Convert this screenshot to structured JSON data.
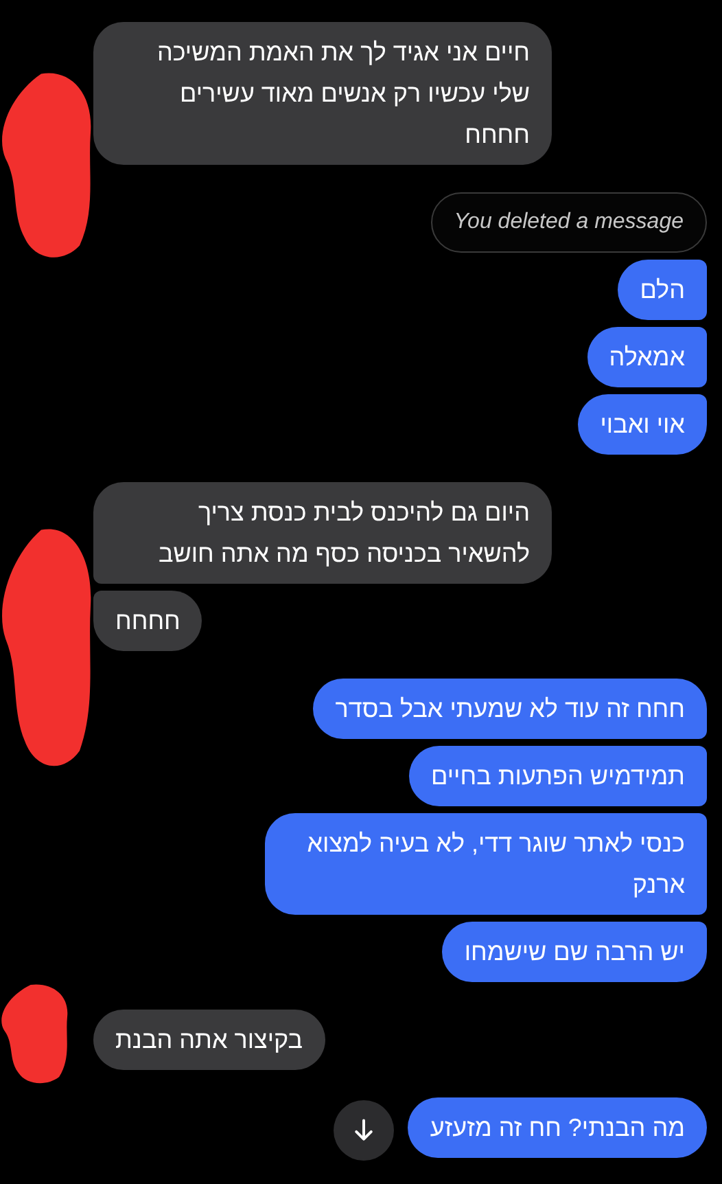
{
  "groups": [
    {
      "outgoing": false,
      "messages": [
        {
          "kind": "text",
          "text": "חיים אני אגיד לך את האמת המשיכה שלי עכשיו רק אנשים מאוד עשירים חחחח"
        }
      ]
    },
    {
      "outgoing": true,
      "messages": [
        {
          "kind": "deleted",
          "text": "You deleted a message"
        },
        {
          "kind": "text",
          "text": "הלם"
        },
        {
          "kind": "text",
          "text": "אמאלה"
        },
        {
          "kind": "text",
          "text": "אוי ואבוי"
        }
      ]
    },
    {
      "outgoing": false,
      "messages": [
        {
          "kind": "text",
          "text": "היום גם להיכנס לבית כנסת צריך להשאיר בכניסה כסף מה אתה חושב"
        },
        {
          "kind": "text",
          "text": "חחחח"
        }
      ]
    },
    {
      "outgoing": true,
      "messages": [
        {
          "kind": "text",
          "text": "חחח זה עוד לא שמעתי אבל בסדר"
        },
        {
          "kind": "text",
          "text": "תמידמיש הפתעות בחיים"
        },
        {
          "kind": "text",
          "text": "כנסי לאתר שוגר דדי, לא בעיה למצוא ארנק"
        },
        {
          "kind": "text",
          "text": "יש הרבה שם שישמחו"
        }
      ]
    },
    {
      "outgoing": false,
      "messages": [
        {
          "kind": "text",
          "text": "בקיצור אתה הבנת"
        }
      ]
    },
    {
      "outgoing": true,
      "scroll_button": true,
      "messages": [
        {
          "kind": "text",
          "text": "מה הבנתי? חח זה מזעזע"
        }
      ]
    }
  ]
}
